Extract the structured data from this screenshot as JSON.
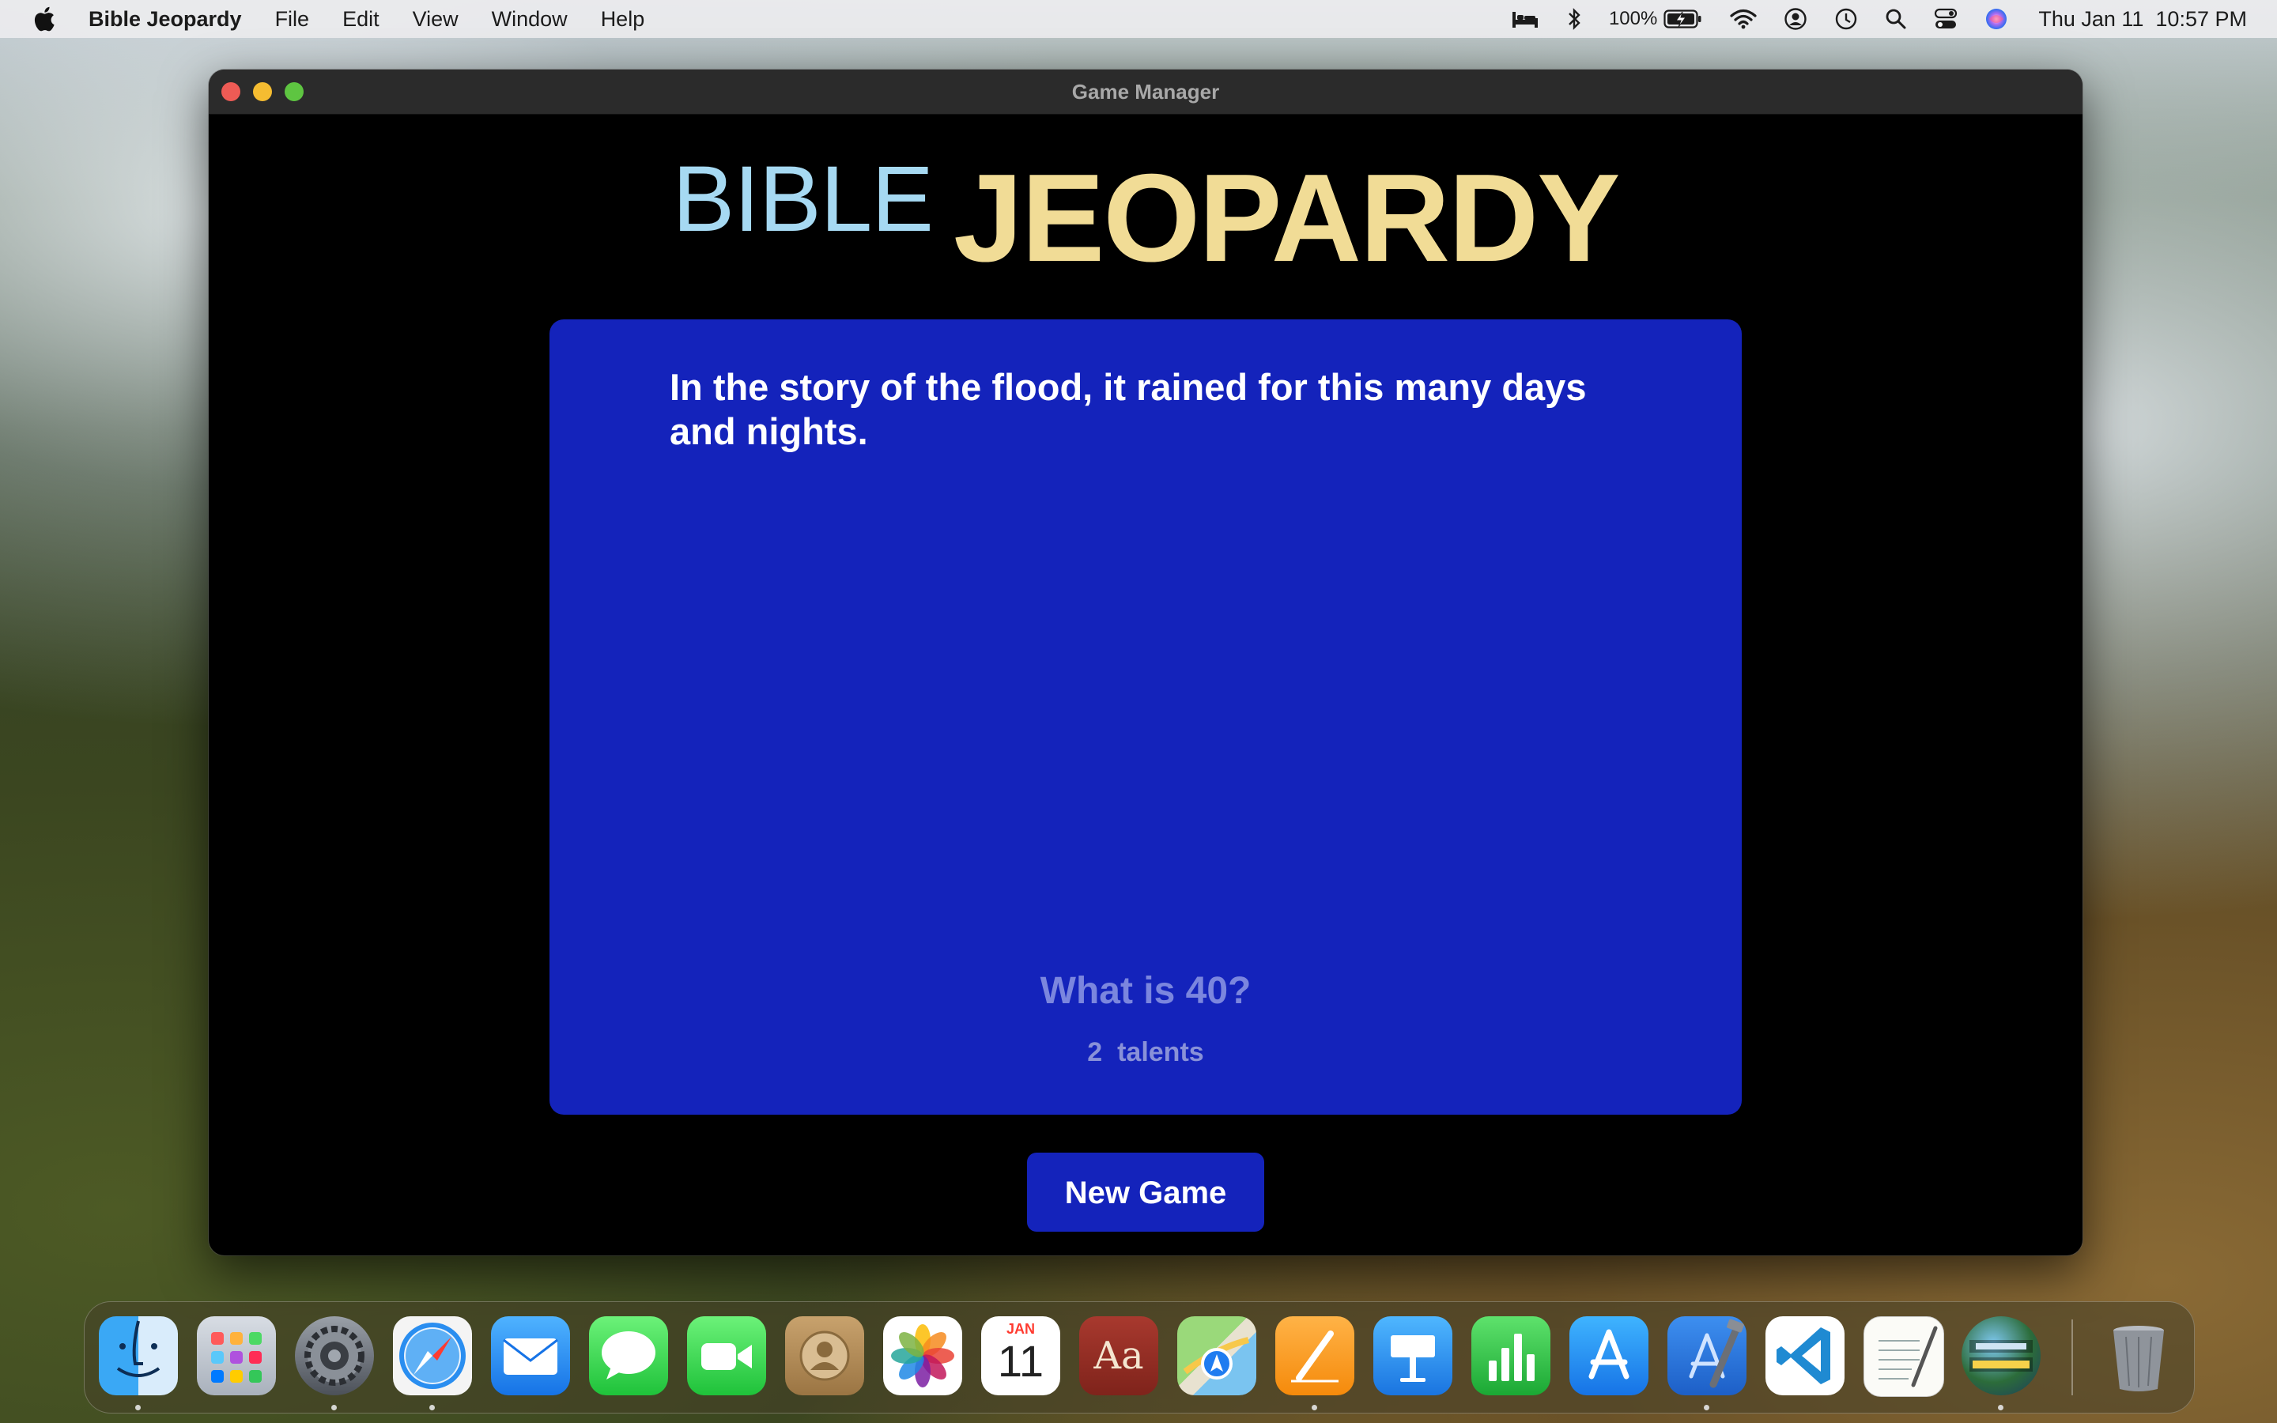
{
  "menubar": {
    "app_name": "Bible Jeopardy",
    "items": [
      "File",
      "Edit",
      "View",
      "Window",
      "Help"
    ],
    "battery_percent": "100%",
    "datetime": "Thu Jan 11  10:57 PM"
  },
  "window": {
    "title": "Game Manager"
  },
  "game": {
    "logo_word1": "BIBLE",
    "logo_word2": "JEOPARDY",
    "question": "In the story of the flood, it rained for this many days and nights.",
    "answer": "What is 40?",
    "points": "2  talents",
    "new_game_label": "New Game"
  },
  "dock": {
    "calendar_month": "JAN",
    "calendar_day": "11",
    "dictionary_label": "Aa",
    "apps": [
      "finder-icon",
      "launchpad-icon",
      "system-settings-icon",
      "safari-icon",
      "mail-icon",
      "messages-icon",
      "facetime-icon",
      "contacts-icon",
      "photos-icon",
      "calendar-icon",
      "dictionary-icon",
      "maps-icon",
      "pages-icon",
      "keynote-icon",
      "numbers-icon",
      "app-store-icon",
      "xcode-icon",
      "vscode-icon",
      "textedit-icon",
      "bible-jeopardy-icon",
      "trash-icon"
    ]
  },
  "colors": {
    "card_blue": "#1423bb",
    "logo_bible": "#a6d9f2",
    "logo_jeopardy": "#f1dc96",
    "answer_text": "#7b86de"
  }
}
